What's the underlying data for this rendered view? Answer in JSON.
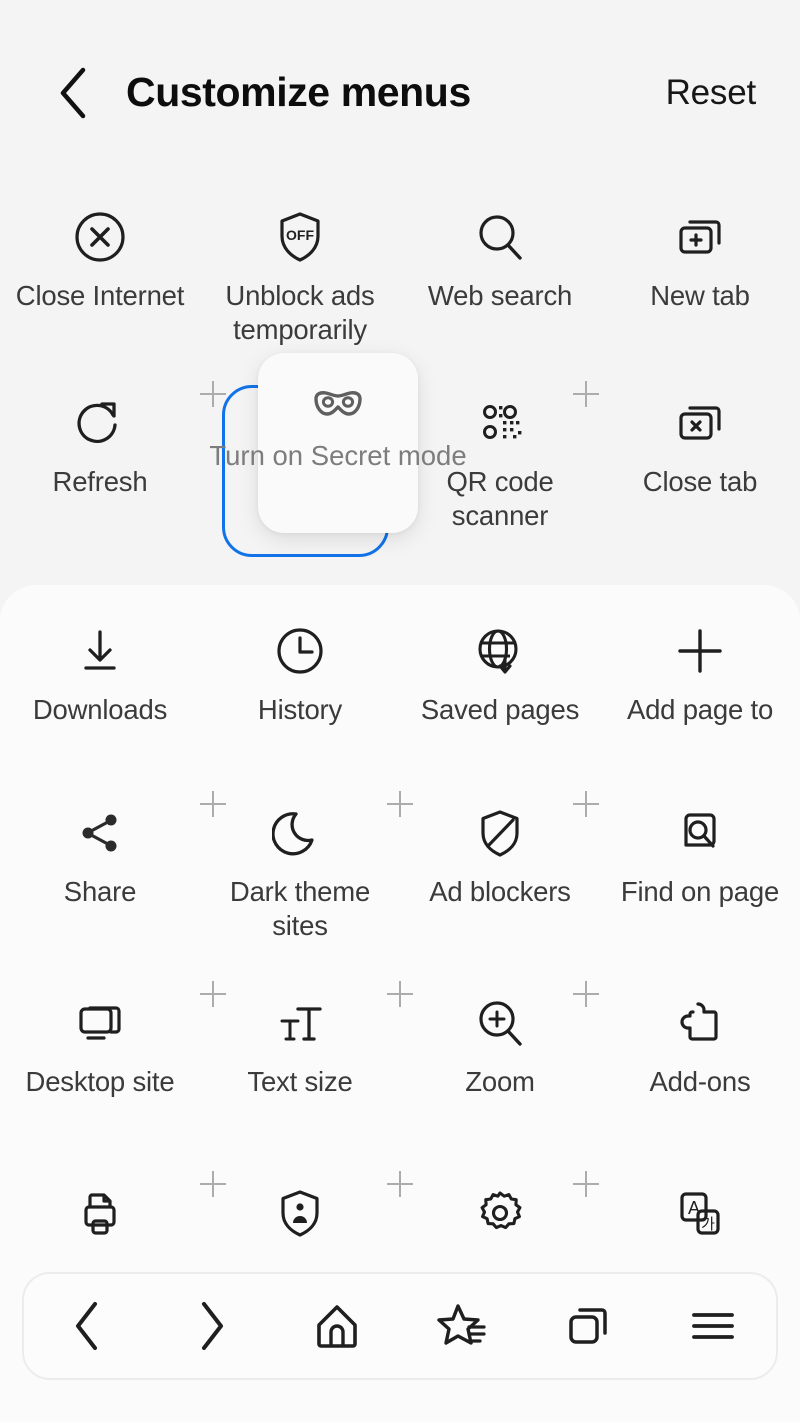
{
  "header": {
    "back_icon": "chevron-left-icon",
    "title": "Customize menus",
    "reset_label": "Reset"
  },
  "top_section": {
    "rows": [
      {
        "items": [
          {
            "label": "Close Internet",
            "icon": "close-circle-icon"
          },
          {
            "label": "Unblock ads temporarily",
            "icon": "shield-off-icon"
          },
          {
            "label": "Web search",
            "icon": "search-icon"
          },
          {
            "label": "New tab",
            "icon": "new-tab-icon"
          }
        ]
      },
      {
        "items": [
          {
            "label": "Refresh",
            "icon": "refresh-icon"
          },
          {
            "label": "",
            "icon": "drop-slot"
          },
          {
            "label": "QR code scanner",
            "icon": "qr-code-icon"
          },
          {
            "label": "Close tab",
            "icon": "close-tab-icon"
          }
        ]
      }
    ]
  },
  "drag": {
    "dragged_label": "Turn on Secret mode",
    "dragged_icon": "mask-icon",
    "drop_target_color": "#1273e8"
  },
  "bottom_panel": {
    "rows": [
      {
        "items": [
          {
            "label": "Downloads",
            "icon": "download-icon"
          },
          {
            "label": "History",
            "icon": "clock-icon"
          },
          {
            "label": "Saved pages",
            "icon": "globe-download-icon"
          },
          {
            "label": "Add page to",
            "icon": "plus-icon"
          }
        ]
      },
      {
        "items": [
          {
            "label": "Share",
            "icon": "share-icon"
          },
          {
            "label": "Dark theme sites",
            "icon": "moon-icon"
          },
          {
            "label": "Ad blockers",
            "icon": "shield-slash-icon"
          },
          {
            "label": "Find on page",
            "icon": "find-in-page-icon"
          }
        ]
      },
      {
        "items": [
          {
            "label": "Desktop site",
            "icon": "desktop-icon"
          },
          {
            "label": "Text size",
            "icon": "text-size-icon"
          },
          {
            "label": "Zoom",
            "icon": "zoom-in-icon"
          },
          {
            "label": "Add-ons",
            "icon": "puzzle-icon"
          }
        ]
      },
      {
        "items": [
          {
            "label": "",
            "icon": "print-icon"
          },
          {
            "label": "",
            "icon": "privacy-shield-icon"
          },
          {
            "label": "",
            "icon": "settings-gear-icon"
          },
          {
            "label": "",
            "icon": "translate-icon"
          }
        ]
      }
    ]
  },
  "nav_bar": {
    "items": [
      {
        "name": "back",
        "icon": "chevron-left-icon"
      },
      {
        "name": "forward",
        "icon": "chevron-right-icon"
      },
      {
        "name": "home",
        "icon": "home-icon"
      },
      {
        "name": "bookmarks",
        "icon": "bookmark-star-icon"
      },
      {
        "name": "tabs",
        "icon": "tabs-icon"
      },
      {
        "name": "menu",
        "icon": "hamburger-menu-icon"
      }
    ]
  },
  "colors": {
    "page_background": "#f4f4f4",
    "panel_background": "#fbfbfb",
    "label_text": "#3b3b3b",
    "accent_blue": "#1273e8"
  }
}
